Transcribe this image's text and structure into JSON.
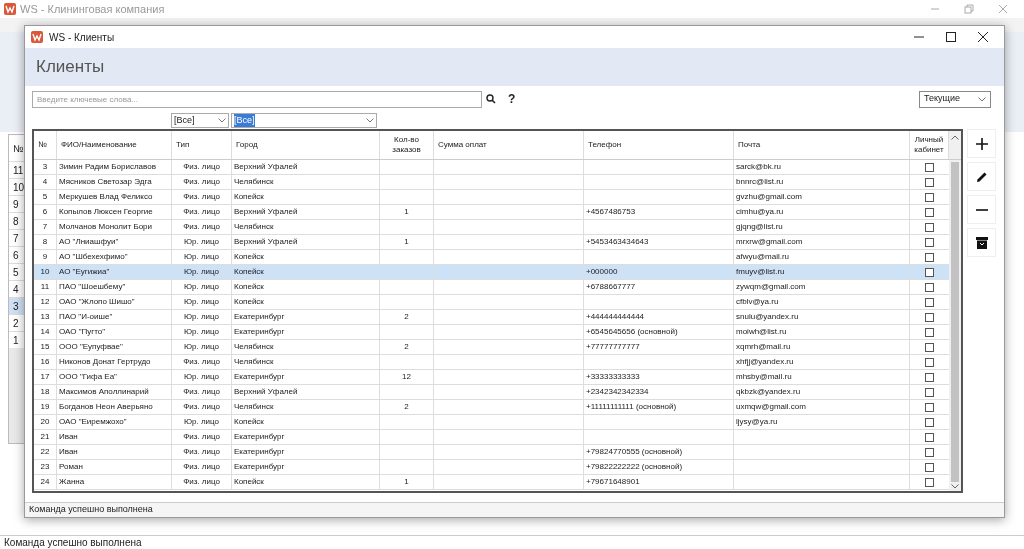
{
  "main_window": {
    "title": "WS - Клининговая компания",
    "status": "Команда успешно выполнена",
    "list": {
      "header": "№",
      "rows": [
        {
          "n": "11",
          "selected": false
        },
        {
          "n": "10",
          "selected": false
        },
        {
          "n": "9",
          "selected": false
        },
        {
          "n": "8",
          "selected": false
        },
        {
          "n": "7",
          "selected": false
        },
        {
          "n": "6",
          "selected": false
        },
        {
          "n": "5",
          "selected": false
        },
        {
          "n": "4",
          "selected": false
        },
        {
          "n": "3",
          "selected": true
        },
        {
          "n": "2",
          "selected": false
        },
        {
          "n": "1",
          "selected": false
        }
      ]
    }
  },
  "dialog": {
    "title": "WS - Клиенты",
    "heading": "Клиенты",
    "search": {
      "placeholder": "Введите ключевые слова...",
      "help": "?"
    },
    "scope": "Текущие",
    "filters": [
      "[Все]",
      "[Все]"
    ],
    "columns": [
      "№",
      "ФИО/Наименование",
      "Тип",
      "Город",
      "Кол-во заказов",
      "Сумма оплат",
      "Телефон",
      "Почта",
      "Личный кабинет"
    ],
    "rows": [
      {
        "n": "3",
        "name": "Зимин Радим Бориславов",
        "type": "Физ. лицо",
        "city": "Верхний Уфалей",
        "orders": "",
        "phone": "",
        "email": "sarck@bk.ru",
        "cabinet": false,
        "selected": false
      },
      {
        "n": "4",
        "name": "Мясников Светозар Эдга",
        "type": "Физ. лицо",
        "city": "Челябинск",
        "orders": "",
        "phone": "",
        "email": "bnnrc@list.ru",
        "cabinet": false,
        "selected": false
      },
      {
        "n": "5",
        "name": "Меркушев Влад Феликсо",
        "type": "Физ. лицо",
        "city": "Копейск",
        "orders": "",
        "phone": "",
        "email": "gvzhu@gmail.com",
        "cabinet": false,
        "selected": false
      },
      {
        "n": "6",
        "name": "Копылов Люксен Георгие",
        "type": "Физ. лицо",
        "city": "Верхний Уфалей",
        "orders": "1",
        "phone": "+4567486753",
        "email": "cimhu@ya.ru",
        "cabinet": false,
        "selected": false
      },
      {
        "n": "7",
        "name": "Молчанов Монолит Бори",
        "type": "Физ. лицо",
        "city": "Челябинск",
        "orders": "",
        "phone": "",
        "email": "gjqng@list.ru",
        "cabinet": false,
        "selected": false
      },
      {
        "n": "8",
        "name": "АО \"Лниашфуи\"",
        "type": "Юр. лицо",
        "city": "Верхний Уфалей",
        "orders": "1",
        "phone": "+5453463434643",
        "email": "mrxrw@gmail.com",
        "cabinet": false,
        "selected": false
      },
      {
        "n": "9",
        "name": "АО \"Шбехехфимо\"",
        "type": "Юр. лицо",
        "city": "Копейск",
        "orders": "",
        "phone": "",
        "email": "afwyu@mail.ru",
        "cabinet": false,
        "selected": false
      },
      {
        "n": "10",
        "name": "АО \"Еугижиа\"",
        "type": "Юр. лицо",
        "city": "Копейск",
        "orders": "",
        "phone": "+000000",
        "email": "fmuyv@list.ru",
        "cabinet": false,
        "selected": true
      },
      {
        "n": "11",
        "name": "ПАО \"Шоешбему\"",
        "type": "Юр. лицо",
        "city": "Копейск",
        "orders": "",
        "phone": "+6788667777",
        "email": "zywqm@gmail.com",
        "cabinet": false,
        "selected": false
      },
      {
        "n": "12",
        "name": "ОАО \"Жлопо Шишо\"",
        "type": "Юр. лицо",
        "city": "Копейск",
        "orders": "",
        "phone": "",
        "email": "cfblv@ya.ru",
        "cabinet": false,
        "selected": false
      },
      {
        "n": "13",
        "name": "ПАО \"И-оише\"",
        "type": "Юр. лицо",
        "city": "Екатеринбург",
        "orders": "2",
        "phone": "+444444444444",
        "email": "snulu@yandex.ru",
        "cabinet": false,
        "selected": false
      },
      {
        "n": "14",
        "name": "ОАО \"Пугто\"",
        "type": "Юр. лицо",
        "city": "Екатеринбург",
        "orders": "",
        "phone": "+6545645656 (основной)",
        "email": "moiwh@list.ru",
        "cabinet": false,
        "selected": false
      },
      {
        "n": "15",
        "name": "ООО \"Еупуфвае\"",
        "type": "Юр. лицо",
        "city": "Челябинск",
        "orders": "2",
        "phone": "+77777777777",
        "email": "xqmrh@mail.ru",
        "cabinet": false,
        "selected": false
      },
      {
        "n": "16",
        "name": "Никонов Донат Гертрудо",
        "type": "Физ. лицо",
        "city": "Челябинск",
        "orders": "",
        "phone": "",
        "email": "xhfjj@yandex.ru",
        "cabinet": false,
        "selected": false
      },
      {
        "n": "17",
        "name": "ООО \"Гифа Еа\"",
        "type": "Юр. лицо",
        "city": "Екатеринбург",
        "orders": "12",
        "phone": "+33333333333",
        "email": "mhsby@mail.ru",
        "cabinet": false,
        "selected": false
      },
      {
        "n": "18",
        "name": "Максимов Аполлинарий",
        "type": "Физ. лицо",
        "city": "Верхний Уфалей",
        "orders": "",
        "phone": "+2342342342334",
        "email": "qkbzk@yandex.ru",
        "cabinet": false,
        "selected": false
      },
      {
        "n": "19",
        "name": "Богданов Неон Аверьяно",
        "type": "Физ. лицо",
        "city": "Челябинск",
        "orders": "2",
        "phone": "+11111111111 (основной)",
        "email": "uxmqw@gmail.com",
        "cabinet": false,
        "selected": false
      },
      {
        "n": "20",
        "name": "ОАО \"Еиремжохо\"",
        "type": "Юр. лицо",
        "city": "Копейск",
        "orders": "",
        "phone": "",
        "email": "ljysy@ya.ru",
        "cabinet": false,
        "selected": false
      },
      {
        "n": "21",
        "name": "Иван",
        "type": "Физ. лицо",
        "city": "Екатеринбург",
        "orders": "",
        "phone": "",
        "email": "",
        "cabinet": false,
        "selected": false
      },
      {
        "n": "22",
        "name": "Иван",
        "type": "Физ. лицо",
        "city": "Екатеринбург",
        "orders": "",
        "phone": "+79824770555 (основной)",
        "email": "",
        "cabinet": false,
        "selected": false
      },
      {
        "n": "23",
        "name": "Роман",
        "type": "Физ. лицо",
        "city": "Екатеринбург",
        "orders": "",
        "phone": "+79822222222 (основной)",
        "email": "",
        "cabinet": false,
        "selected": false
      },
      {
        "n": "24",
        "name": "Жанна",
        "type": "Физ. лицо",
        "city": "Копейск",
        "orders": "1",
        "phone": "+79671648901",
        "email": "",
        "cabinet": false,
        "selected": false
      }
    ],
    "status": "Команда успешно выполнена"
  }
}
